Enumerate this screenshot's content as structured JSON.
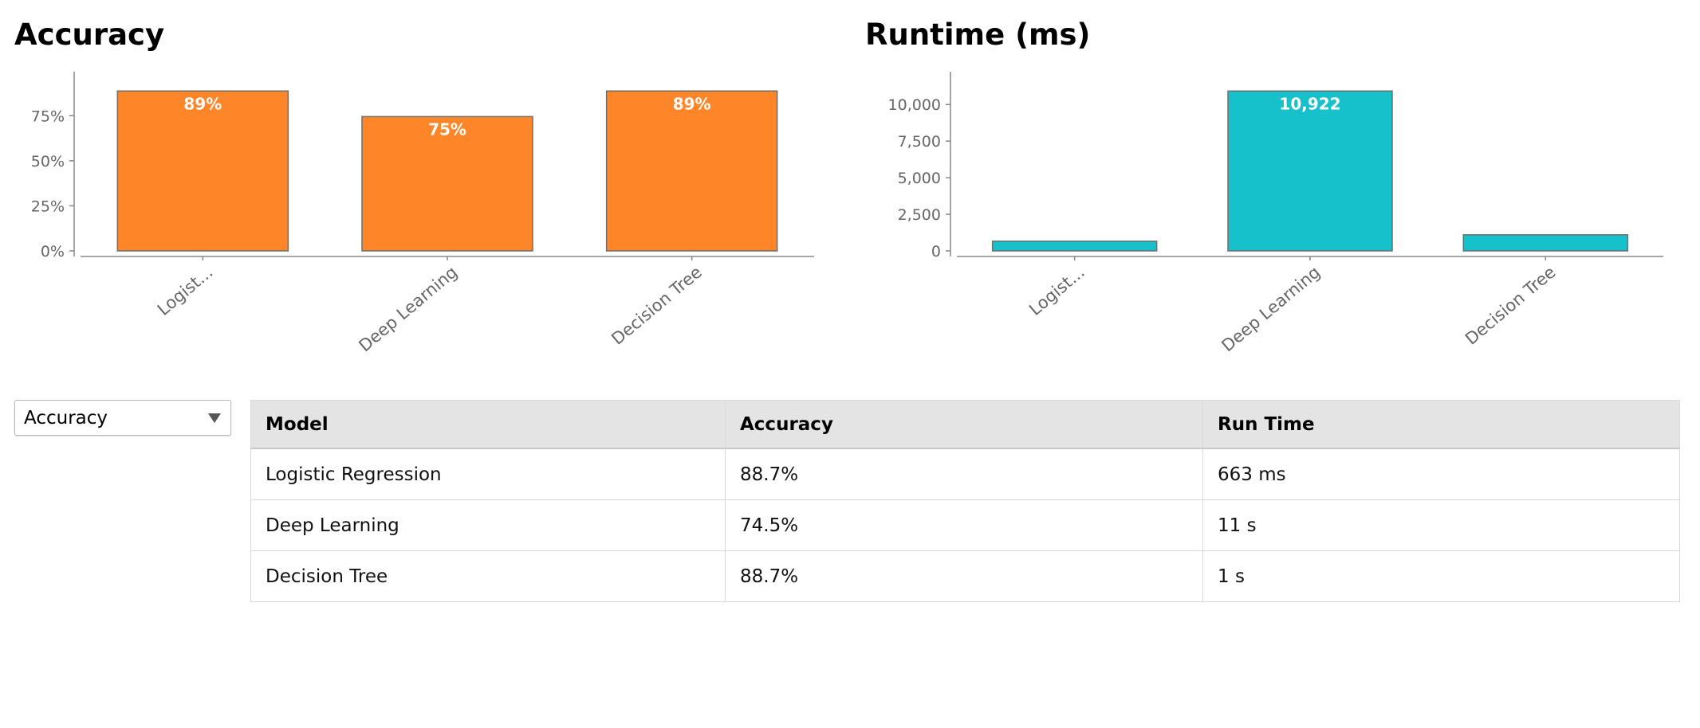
{
  "charts": {
    "accuracy_title": "Accuracy",
    "runtime_title": "Runtime (ms)"
  },
  "chart_data": [
    {
      "type": "bar",
      "title": "Accuracy",
      "categories": [
        "Logist...",
        "Deep Learning",
        "Decision Tree"
      ],
      "values": [
        0.887,
        0.745,
        0.887
      ],
      "data_labels": [
        "89%",
        "75%",
        "89%"
      ],
      "y_ticks": [
        "0%",
        "25%",
        "50%",
        "75%"
      ],
      "y_tick_values": [
        0,
        0.25,
        0.5,
        0.75
      ],
      "ylim": [
        0,
        0.95
      ],
      "color": "#fe8629",
      "grid": false,
      "legend": "none"
    },
    {
      "type": "bar",
      "title": "Runtime (ms)",
      "categories": [
        "Logist...",
        "Deep Learning",
        "Decision Tree"
      ],
      "values": [
        663,
        10922,
        1100
      ],
      "data_labels": [
        "",
        "10,922",
        ""
      ],
      "y_ticks": [
        "0",
        "2,500",
        "5,000",
        "7,500",
        "10,000"
      ],
      "y_tick_values": [
        0,
        2500,
        5000,
        7500,
        10000
      ],
      "ylim": [
        0,
        11700
      ],
      "color": "#17c1cb",
      "grid": false,
      "legend": "none"
    }
  ],
  "dropdown": {
    "selected": "Accuracy"
  },
  "table": {
    "headers": [
      "Model",
      "Accuracy",
      "Run Time"
    ],
    "rows": [
      [
        "Logistic Regression",
        "88.7%",
        "663 ms"
      ],
      [
        "Deep Learning",
        "74.5%",
        "11 s"
      ],
      [
        "Decision Tree",
        "88.7%",
        "1 s"
      ]
    ]
  }
}
